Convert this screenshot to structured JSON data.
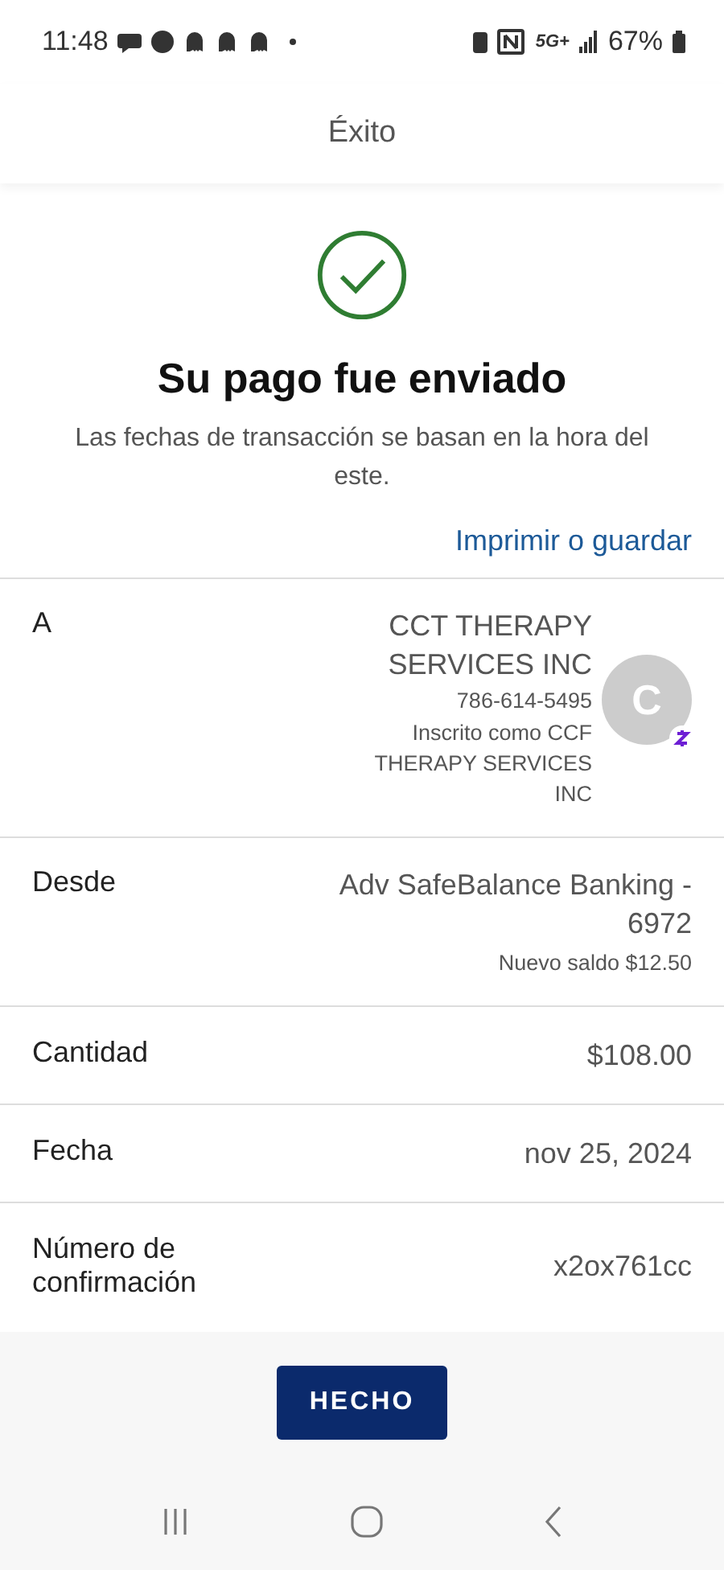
{
  "status_bar": {
    "time": "11:48",
    "network": "5G+",
    "battery": "67%"
  },
  "header": {
    "title": "Éxito"
  },
  "result": {
    "heading": "Su pago fue enviado",
    "note": "Las fechas de transacción se basan en la hora del este.",
    "link": "Imprimir o guardar"
  },
  "details": [
    {
      "kind": "recipient",
      "label": "A",
      "name": "CCT THERAPY SERVICES INC",
      "phone": "786-614-5495",
      "enrolled": "Inscrito como CCF THERAPY SERVICES INC",
      "avatar": "C"
    },
    {
      "kind": "account",
      "label": "Desde",
      "value": "Adv SafeBalance Banking - 6972",
      "sub": "Nuevo saldo $12.50"
    },
    {
      "kind": "plain",
      "label": "Cantidad",
      "value": "$108.00"
    },
    {
      "kind": "plain",
      "label": "Fecha",
      "value": "nov 25, 2024"
    },
    {
      "kind": "plain",
      "label": "Número de confirmación",
      "value": "x2ox761cc"
    }
  ],
  "footer": {
    "button": "HECHO"
  }
}
